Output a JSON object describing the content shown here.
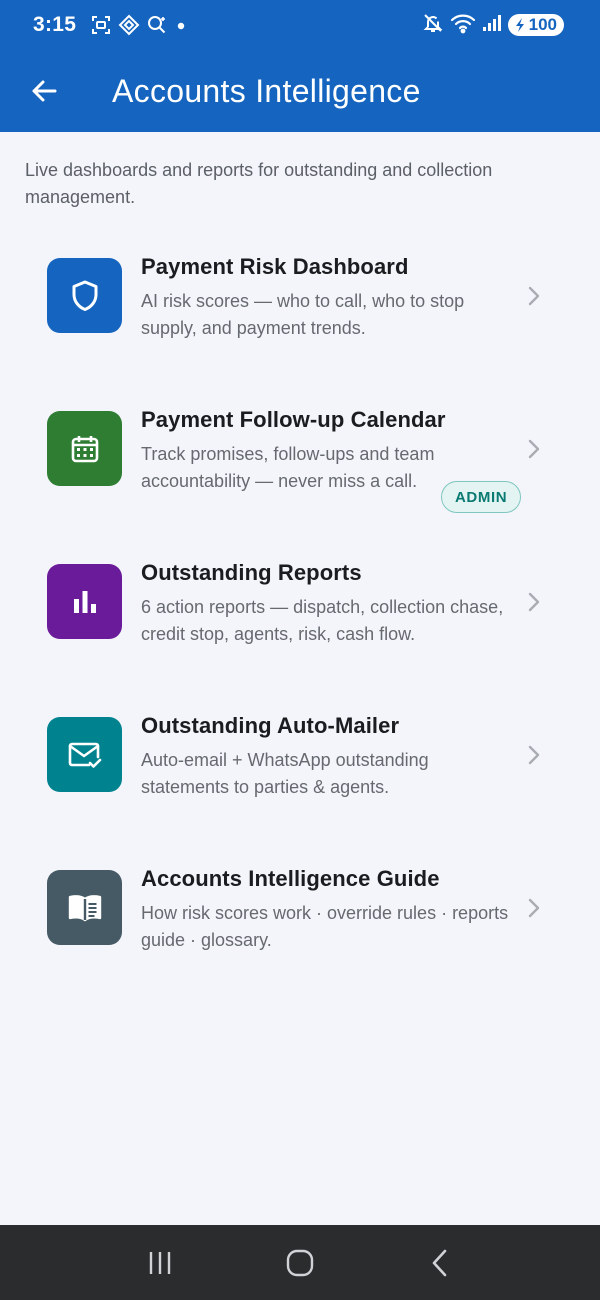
{
  "status_bar": {
    "time": "3:15",
    "battery": "100",
    "icons": [
      "screenshot-icon",
      "vpn-icon",
      "search-sparkle-icon",
      "dot-icon",
      "mute-icon",
      "wifi-icon",
      "signal-icon",
      "battery-icon"
    ]
  },
  "app_bar": {
    "title": "Accounts Intelligence",
    "back_icon": "arrow-left-icon"
  },
  "intro": "Live dashboards and reports for outstanding and collection management.",
  "items": [
    {
      "title": "Payment Risk Dashboard",
      "description": "AI risk scores — who to call, who to stop supply, and payment trends.",
      "icon": "shield-icon",
      "color": "#1565c0"
    },
    {
      "title": "Payment Follow-up Calendar",
      "description": "Track promises, follow-ups and team accountability — never miss a call.",
      "icon": "calendar-icon",
      "color": "#2e7d32"
    },
    {
      "title": "Outstanding Reports",
      "description": "6 action reports — dispatch, collection chase, credit stop, agents, risk, cash flow.",
      "icon": "bar-chart-icon",
      "color": "#6a1b9a"
    },
    {
      "title": "Outstanding Auto-Mailer",
      "description": "Auto-email + WhatsApp outstanding statements to parties & agents.",
      "icon": "mail-check-icon",
      "color": "#00838f",
      "badge": "ADMIN"
    },
    {
      "title": "Accounts Intelligence Guide",
      "description": "How risk scores work · override rules · reports guide · glossary.",
      "icon": "book-icon",
      "color": "#455a64"
    }
  ],
  "nav_bar": {
    "buttons": [
      "recents-icon",
      "home-icon",
      "back-icon"
    ]
  }
}
